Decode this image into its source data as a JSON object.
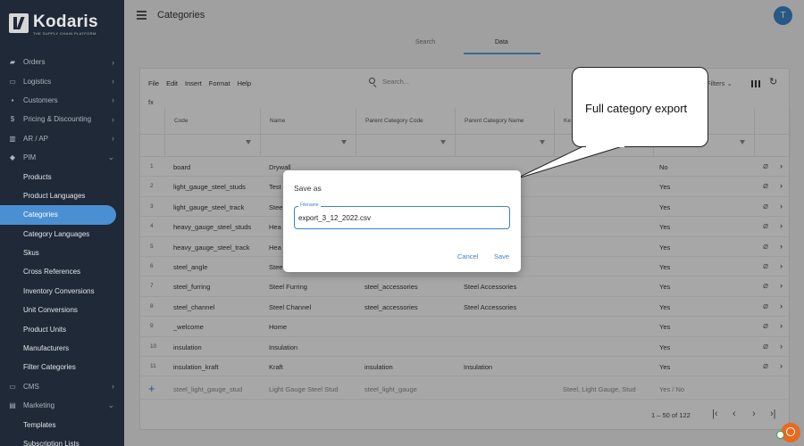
{
  "app": {
    "logo_name": "Kodaris",
    "logo_tagline": "THE SUPPLY CHAIN PLATFORM",
    "page_title": "Categories",
    "avatar_initial": "T"
  },
  "sidebar": {
    "items": [
      {
        "label": "Orders",
        "icon": "truck-icon",
        "glyph": "▰",
        "chevron": "›",
        "sub": false
      },
      {
        "label": "Logistics",
        "icon": "logistics-icon",
        "glyph": "▭",
        "chevron": "›",
        "sub": false
      },
      {
        "label": "Customers",
        "icon": "customers-icon",
        "glyph": "▪",
        "chevron": "›",
        "sub": false
      },
      {
        "label": "Pricing & Discounting",
        "icon": "dollar-icon",
        "glyph": "$",
        "chevron": "›",
        "sub": false
      },
      {
        "label": "AR / AP",
        "icon": "bank-icon",
        "glyph": "▥",
        "chevron": "›",
        "sub": false
      },
      {
        "label": "PIM",
        "icon": "tag-icon",
        "glyph": "◆",
        "chevron": "⌄",
        "sub": false
      },
      {
        "label": "Products",
        "sub": true
      },
      {
        "label": "Product Languages",
        "sub": true
      },
      {
        "label": "Categories",
        "sub": true,
        "active": true
      },
      {
        "label": "Category Languages",
        "sub": true
      },
      {
        "label": "Skus",
        "sub": true
      },
      {
        "label": "Cross References",
        "sub": true
      },
      {
        "label": "Inventory Conversions",
        "sub": true
      },
      {
        "label": "Unit Conversions",
        "sub": true
      },
      {
        "label": "Product Units",
        "sub": true
      },
      {
        "label": "Manufacturers",
        "sub": true
      },
      {
        "label": "Filter Categories",
        "sub": true
      },
      {
        "label": "CMS",
        "icon": "cms-icon",
        "glyph": "▭",
        "chevron": "›",
        "sub": false
      },
      {
        "label": "Marketing",
        "icon": "marketing-icon",
        "glyph": "▤",
        "chevron": "⌄",
        "sub": false
      },
      {
        "label": "Templates",
        "sub": true
      },
      {
        "label": "Subscription Lists",
        "sub": true
      }
    ]
  },
  "tabs": {
    "search": "Search",
    "data": "Data"
  },
  "toolbar": {
    "menus": [
      "File",
      "Edit",
      "Insert",
      "Format",
      "Help"
    ],
    "search_placeholder": "Search...",
    "filters_label": "Filters",
    "fx": "fx"
  },
  "grid": {
    "columns": [
      "Code",
      "Name",
      "Parent Category Code",
      "Parent Category Name",
      "Ke",
      ""
    ],
    "rows": [
      {
        "n": "1",
        "code": "board",
        "name": "Drywall",
        "pcode": "",
        "pname": "",
        "kw": "",
        "flag": "No"
      },
      {
        "n": "2",
        "code": "light_gauge_steel_studs",
        "name": "Test",
        "pcode": "",
        "pname": "",
        "kw": "",
        "flag": "Yes"
      },
      {
        "n": "3",
        "code": "light_gauge_steel_track",
        "name": "Stee",
        "pcode": "",
        "pname": "",
        "kw": "",
        "flag": "Yes"
      },
      {
        "n": "4",
        "code": "heavy_gauge_steel_studs",
        "name": "Hea",
        "pcode": "",
        "pname": "",
        "kw": "",
        "flag": "Yes"
      },
      {
        "n": "5",
        "code": "heavy_gauge_steel_track",
        "name": "Hea",
        "pcode": "",
        "pname": "",
        "kw": "",
        "flag": "Yes"
      },
      {
        "n": "6",
        "code": "steel_angle",
        "name": "Stee",
        "pcode": "",
        "pname": "",
        "kw": "",
        "flag": "Yes"
      },
      {
        "n": "7",
        "code": "steel_furring",
        "name": "Steel Furring",
        "pcode": "steel_accessories",
        "pname": "Steel Accessories",
        "kw": "",
        "flag": "Yes"
      },
      {
        "n": "8",
        "code": "steel_channel",
        "name": "Steel Channel",
        "pcode": "steel_accessories",
        "pname": "Steel Accessories",
        "kw": "",
        "flag": "Yes"
      },
      {
        "n": "9",
        "code": "_welcome",
        "name": "Home",
        "pcode": "",
        "pname": "",
        "kw": "",
        "flag": "Yes"
      },
      {
        "n": "10",
        "code": "insulation",
        "name": "Insulation",
        "pcode": "",
        "pname": "",
        "kw": "",
        "flag": "Yes"
      },
      {
        "n": "11",
        "code": "insulation_kraft",
        "name": "Kraft",
        "pcode": "insulation",
        "pname": "Insulation",
        "kw": "",
        "flag": "Yes"
      }
    ],
    "new_row": {
      "code": "steel_light_gauge_stud",
      "name": "Light Gauge Steel Stud",
      "pcode": "steel_light_gauge",
      "pname": "",
      "kw": "Steel, Light Gauge, Stud",
      "flag": "Yes / No"
    },
    "pagination": "1 – 50 of 122"
  },
  "dialog": {
    "title": "Save as",
    "field_label": "Filename",
    "filename": "export_3_12_2022.csv",
    "cancel": "Cancel",
    "save": "Save"
  },
  "callout": {
    "text": "Full category export"
  },
  "colors": {
    "accent": "#3b82c4",
    "sidebar_bg": "#1f2937",
    "active_nav": "#4a8fd1"
  }
}
